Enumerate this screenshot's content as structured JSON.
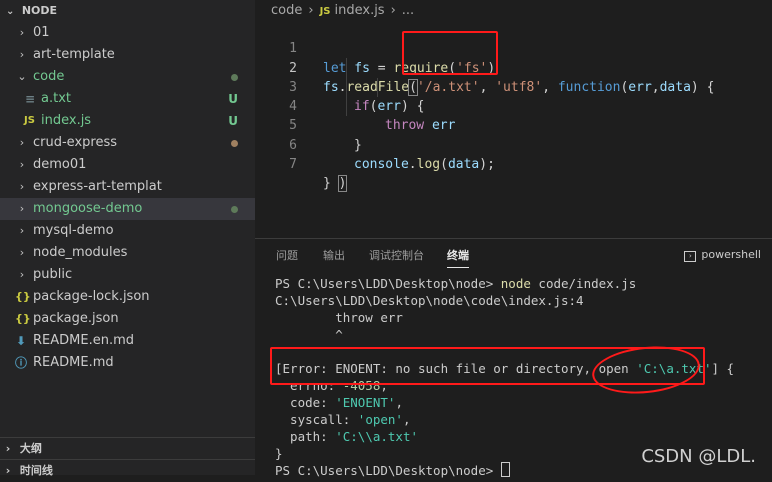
{
  "explorer": {
    "title": "NODE",
    "items": [
      {
        "label": "01",
        "type": "folder",
        "chevron": "›"
      },
      {
        "label": "art-template",
        "type": "folder",
        "chevron": "›"
      },
      {
        "label": "code",
        "type": "folder-open",
        "chevron": "⌄"
      },
      {
        "label": "a.txt",
        "type": "file",
        "icon": "≡",
        "git": "U"
      },
      {
        "label": "index.js",
        "type": "js",
        "icon": "JS",
        "git": "U"
      },
      {
        "label": "crud-express",
        "type": "folder",
        "chevron": "›"
      },
      {
        "label": "demo01",
        "type": "folder",
        "chevron": "›"
      },
      {
        "label": "express-art-templat",
        "type": "folder",
        "chevron": "›"
      },
      {
        "label": "mongoose-demo",
        "type": "folder",
        "chevron": "›"
      },
      {
        "label": "mysql-demo",
        "type": "folder",
        "chevron": "›"
      },
      {
        "label": "node_modules",
        "type": "folder",
        "chevron": "›"
      },
      {
        "label": "public",
        "type": "folder",
        "chevron": "›"
      },
      {
        "label": "package-lock.json",
        "type": "json",
        "icon": "{}"
      },
      {
        "label": "package.json",
        "type": "json",
        "icon": "{}"
      },
      {
        "label": "README.en.md",
        "type": "md",
        "icon": "⬇"
      },
      {
        "label": "README.md",
        "type": "info",
        "icon": "ⓘ"
      }
    ],
    "outline_label": "大纲",
    "timeline_label": "时间线",
    "collapsed_chevron": "›"
  },
  "editor": {
    "breadcrumb": {
      "folder": "code",
      "sep": "›",
      "js_badge": "JS",
      "file": "index.js",
      "ellipsis": "..."
    },
    "line_numbers": [
      "1",
      "2",
      "3",
      "4",
      "5",
      "6",
      "7"
    ],
    "code": {
      "l1_kw": "let",
      "l1_var": " fs",
      "l1_eq": " = ",
      "l1_fn": "require",
      "l1_open": "(",
      "l1_str": "'fs'",
      "l1_close": ")",
      "l2_obj": "fs",
      "l2_dot": ".",
      "l2_fn": "readFile",
      "l2_paren": "(",
      "l2_str1": "'/a.txt'",
      "l2_comma": ", ",
      "l2_str2": "'utf8'",
      "l2_comma2": ", ",
      "l2_kw": "function",
      "l2_params_open": "(",
      "l2_p1": "err",
      "l2_pc": ",",
      "l2_p2": "data",
      "l2_params_close": ") {",
      "l3_kw": "if",
      "l3_open": "(",
      "l3_var": "err",
      "l3_close": ") {",
      "l4_kw": "throw",
      "l4_var": " err",
      "l5": "}",
      "l6_obj": "console",
      "l6_dot": ".",
      "l6_fn": "log",
      "l6_open": "(",
      "l6_var": "data",
      "l6_close": ");",
      "l7_brace": "} ",
      "l7_paren": ")"
    }
  },
  "panel": {
    "tabs": [
      "问题",
      "输出",
      "调试控制台",
      "终端"
    ],
    "active_tab": "终端",
    "shell": "powershell",
    "terminal": {
      "t1_prompt": "PS C:\\Users\\LDD\\Desktop\\node> ",
      "t1_cmd": "node",
      "t1_arg": " code/index.js",
      "t2": "C:\\Users\\LDD\\Desktop\\node\\code\\index.js:4",
      "t3": "        throw err",
      "t4": "        ^",
      "t5": "",
      "t6_a": "[Error: ENOENT: no such file or directory, open ",
      "t6_b": "'C:\\a.txt'",
      "t6_c": "] {",
      "t7_a": "  errno: ",
      "t7_b": "-4058",
      "t7_c": ",",
      "t8_a": "  code: ",
      "t8_b": "'ENOENT'",
      "t8_c": ",",
      "t9_a": "  syscall: ",
      "t9_b": "'open'",
      "t9_c": ",",
      "t10_a": "  path: ",
      "t10_b": "'C:\\\\a.txt'",
      "t11": "}",
      "t12_prompt": "PS C:\\Users\\LDD\\Desktop\\node> "
    }
  },
  "watermark": "CSDN @LDL.",
  "colors": {
    "annotation": "#ff1a1a",
    "accent": "#73c991"
  }
}
